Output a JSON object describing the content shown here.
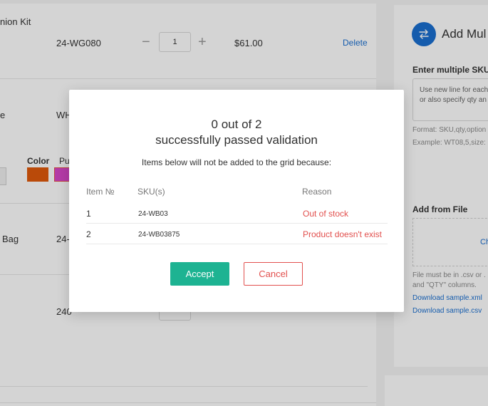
{
  "background": {
    "rows": [
      {
        "name": "nion Kit",
        "sku": "24-WG080",
        "qty": "1",
        "price": "$61.00",
        "action": "Delete"
      },
      {
        "name": "e",
        "sku": "WH"
      },
      {
        "name": "Bag",
        "sku": "24-"
      },
      {
        "sku": "240"
      }
    ],
    "color_label": "Color",
    "color_option_text": "Pu",
    "swatches": {
      "orange": "#e05a0c",
      "purple": "#d946c9"
    },
    "side": {
      "title": "Add Mul",
      "section_label": "Enter multiple SKU",
      "textarea_placeholder_line1": "Use new line for each",
      "textarea_placeholder_line2": "or also specify qty an",
      "format_hint": "Format: SKU,qty,option",
      "example_hint": "Example: WT08,5,size:",
      "add_from_file": "Add from File",
      "drop_zone_text": "Ch",
      "file_hint_line1": "File must be in .csv or .",
      "file_hint_line2": "and \"QTY\" columns.",
      "download_xml": "Download sample.xml",
      "download_csv": "Download sample.csv"
    }
  },
  "modal": {
    "title_line1": "0 out of 2",
    "title_line2": "successfully passed validation",
    "subtitle": "Items below will not be added to the grid because:",
    "columns": {
      "item": "Item №",
      "sku": "SKU(s)",
      "reason": "Reason"
    },
    "rows": [
      {
        "item": "1",
        "sku": "24-WB03",
        "reason": "Out of stock"
      },
      {
        "item": "2",
        "sku": "24-WB03875",
        "reason": "Product doesn't exist"
      }
    ],
    "accept_label": "Accept",
    "cancel_label": "Cancel"
  },
  "colors": {
    "accent": "#1db392",
    "error": "#e2504e",
    "link": "#1a6fd0"
  }
}
